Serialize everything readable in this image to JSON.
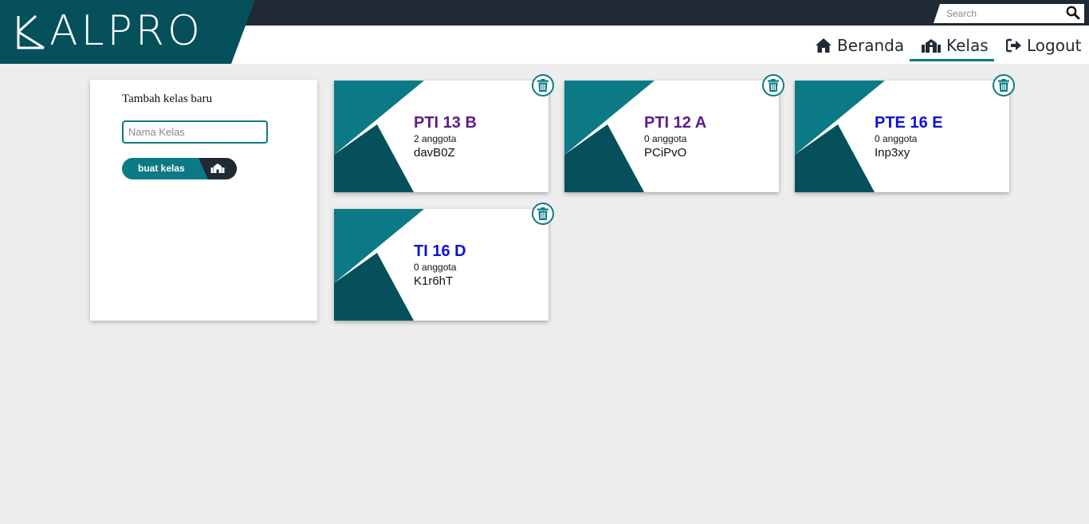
{
  "app": {
    "logo_text": "ALPRO"
  },
  "search": {
    "placeholder": "Search"
  },
  "nav": {
    "items": [
      {
        "label": "Beranda",
        "icon": "home-icon"
      },
      {
        "label": "Kelas",
        "icon": "school-icon",
        "active": true
      },
      {
        "label": "Logout",
        "icon": "sign-out-icon"
      }
    ]
  },
  "panel": {
    "title": "Tambah kelas baru",
    "input_placeholder": "Nama Kelas",
    "button_label": "buat kelas"
  },
  "classes": [
    {
      "name": "PTI 13 B",
      "members": "2 anggota",
      "code": "davB0Z",
      "name_color": "#5b1c86"
    },
    {
      "name": "PTI 12 A",
      "members": "0 anggota",
      "code": "PCiPvO",
      "name_color": "#5b1c86"
    },
    {
      "name": "PTE 16 E",
      "members": "0 anggota",
      "code": "Inp3xy",
      "name_color": "#1010d8"
    },
    {
      "name": "TI 16 D",
      "members": "0 anggota",
      "code": "K1r6hT",
      "name_color": "#1010d8"
    }
  ],
  "colors": {
    "teal": "#0b7a86",
    "dark_teal": "#05505a",
    "header_dark": "#1f2a35"
  }
}
